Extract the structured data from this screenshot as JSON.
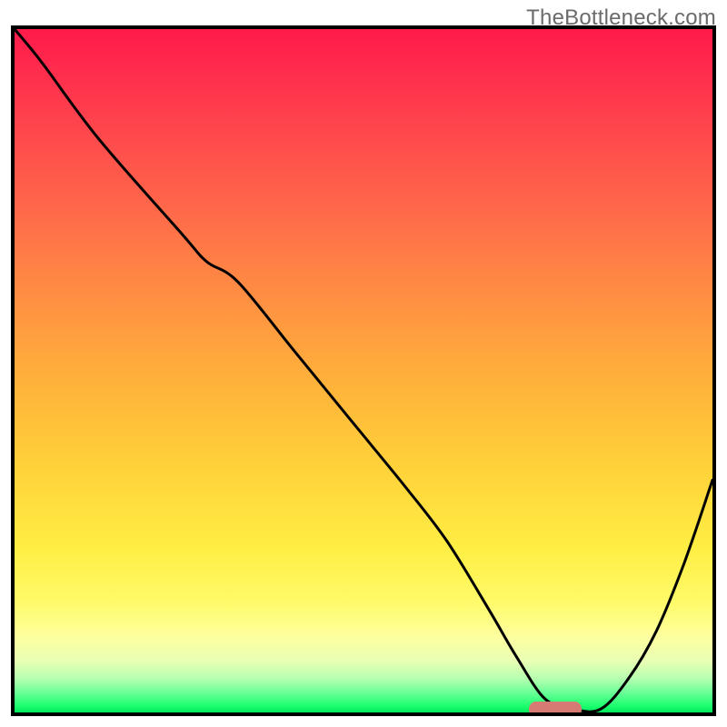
{
  "watermark": "TheBottleneck.com",
  "chart_data": {
    "type": "line",
    "title": "",
    "xlabel": "",
    "ylabel": "",
    "xlim": [
      0,
      100
    ],
    "ylim": [
      0,
      100
    ],
    "grid": false,
    "legend": false,
    "background_gradient": {
      "top": "#ff1a4c",
      "mid": "#ffd43a",
      "bottom": "#00e85c"
    },
    "series": [
      {
        "name": "bottleneck-curve",
        "color": "#000000",
        "x": [
          0,
          4,
          12,
          24,
          27.5,
          32,
          40,
          48,
          56,
          62,
          68,
          72,
          76,
          80,
          84,
          88,
          92,
          96,
          100
        ],
        "y": [
          100,
          95,
          84,
          70,
          66,
          63,
          53,
          43,
          33,
          25,
          15,
          8,
          2,
          0.5,
          0.5,
          5,
          12,
          22,
          34
        ]
      }
    ],
    "marker": {
      "name": "optimal-range",
      "shape": "pill",
      "color": "#d87a74",
      "x_center": 77.5,
      "y": 0.5,
      "width": 7.5,
      "height": 2.3
    }
  }
}
